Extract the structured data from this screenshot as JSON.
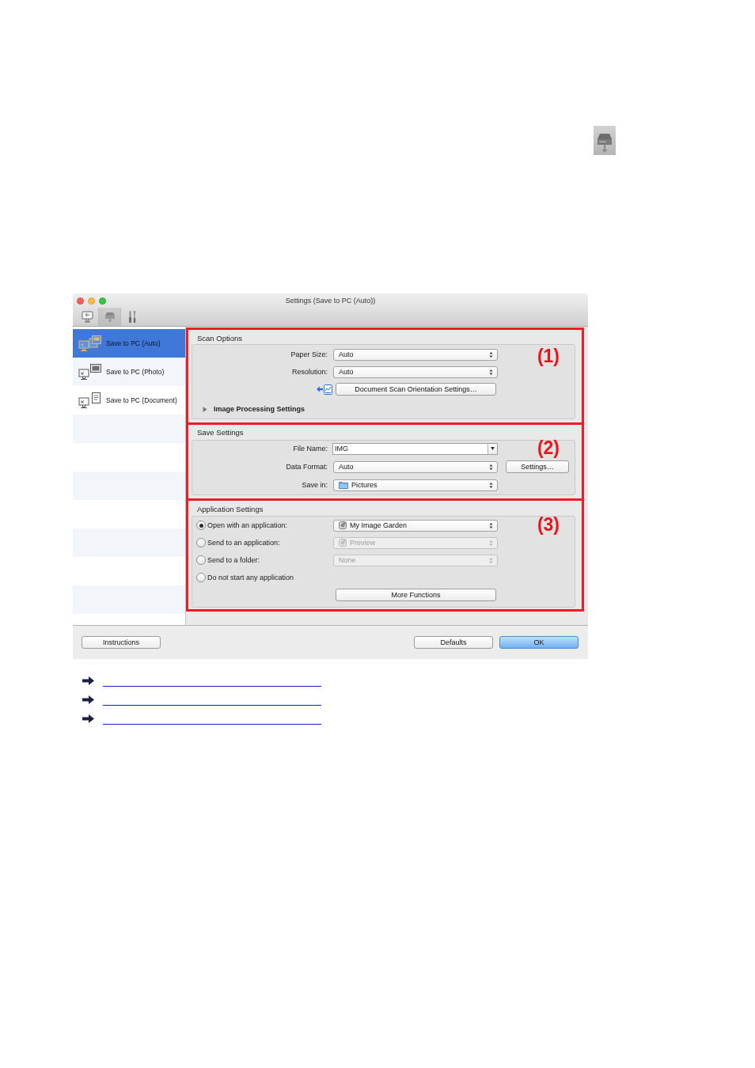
{
  "window": {
    "title": "Settings (Save to PC (Auto))"
  },
  "toolbar": {
    "tabs": [
      {
        "kind": "computer",
        "selected": false
      },
      {
        "kind": "scanner",
        "selected": true
      },
      {
        "kind": "tools",
        "selected": false
      }
    ]
  },
  "sidebar": {
    "items": [
      {
        "kind": "auto",
        "label": "Save to PC (Auto)",
        "selected": true
      },
      {
        "kind": "photo",
        "label": "Save to PC (Photo)",
        "selected": false
      },
      {
        "kind": "document",
        "label": "Save to PC (Document)",
        "selected": false
      }
    ]
  },
  "scan_options": {
    "title": "Scan Options",
    "annotation": "(1)",
    "fields": [
      {
        "label": "Paper Size:",
        "value": "Auto"
      },
      {
        "label": "Resolution:",
        "value": "Auto"
      }
    ],
    "orientation_button": "Document Scan Orientation Settings…",
    "image_processing": {
      "label": "Image Processing Settings",
      "expanded": false
    }
  },
  "save_settings": {
    "title": "Save Settings",
    "annotation": "(2)",
    "fields": [
      {
        "kind": "combo",
        "label": "File Name:",
        "value": "IMG"
      },
      {
        "kind": "popup",
        "label": "Data Format:",
        "value": "Auto",
        "button": "Settings…"
      },
      {
        "kind": "folder",
        "label": "Save in:",
        "value": "Pictures"
      }
    ]
  },
  "application_settings": {
    "title": "Application Settings",
    "annotation": "(3)",
    "options": [
      {
        "label": "Open with an application:",
        "selected": true,
        "popup": {
          "kind": "app",
          "value": "My Image Garden",
          "disabled": false
        }
      },
      {
        "label": "Send to an application:",
        "selected": false,
        "popup": {
          "kind": "app",
          "value": "Preview",
          "disabled": true
        }
      },
      {
        "label": "Send to a folder:",
        "selected": false,
        "popup": {
          "kind": "plain",
          "value": "None",
          "disabled": true
        }
      },
      {
        "label": "Do not start any application",
        "selected": false
      }
    ],
    "more_button": "More Functions"
  },
  "footer": {
    "left_buttons": [
      {
        "kind": "plain",
        "label": "Instructions"
      }
    ],
    "right_buttons": [
      {
        "kind": "plain",
        "label": "Defaults"
      },
      {
        "kind": "primary",
        "label": "OK"
      }
    ]
  },
  "related_links": [
    {
      "kind": "arrow"
    },
    {
      "kind": "arrow"
    },
    {
      "kind": "arrow"
    }
  ]
}
